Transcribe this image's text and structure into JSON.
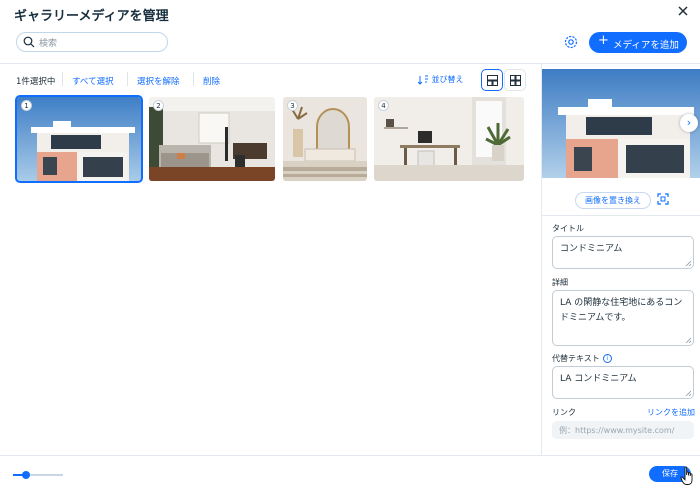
{
  "header": {
    "title": "ギャラリーメディアを管理"
  },
  "search": {
    "placeholder": "検索"
  },
  "actions": {
    "add_media": "メディアを追加"
  },
  "toolbar": {
    "selected_count": "1件選択中",
    "select_all": "すべて選択",
    "deselect": "選択を解除",
    "delete": "削除",
    "sort": "並び替え"
  },
  "gallery": {
    "items": [
      {
        "num": "1",
        "subject": "modern-house",
        "selected": true
      },
      {
        "num": "2",
        "subject": "living-room",
        "selected": false
      },
      {
        "num": "3",
        "subject": "arched-mirror",
        "selected": false
      },
      {
        "num": "4",
        "subject": "home-office",
        "selected": false
      }
    ]
  },
  "details": {
    "replace_image": "画像を置き換え",
    "title_label": "タイトル",
    "title_value": "コンドミニアム",
    "description_label": "詳細",
    "description_value": "LA の閑静な住宅地にあるコンドミニアムです。",
    "alt_label": "代替テキスト",
    "alt_value": "LA コンドミニアム",
    "link_label": "リンク",
    "link_add": "リンクを追加",
    "link_placeholder": "例：https://www.mysite.com/"
  },
  "footer": {
    "save": "保存",
    "zoom_level": 0.25
  },
  "colors": {
    "accent": "#116dff"
  }
}
